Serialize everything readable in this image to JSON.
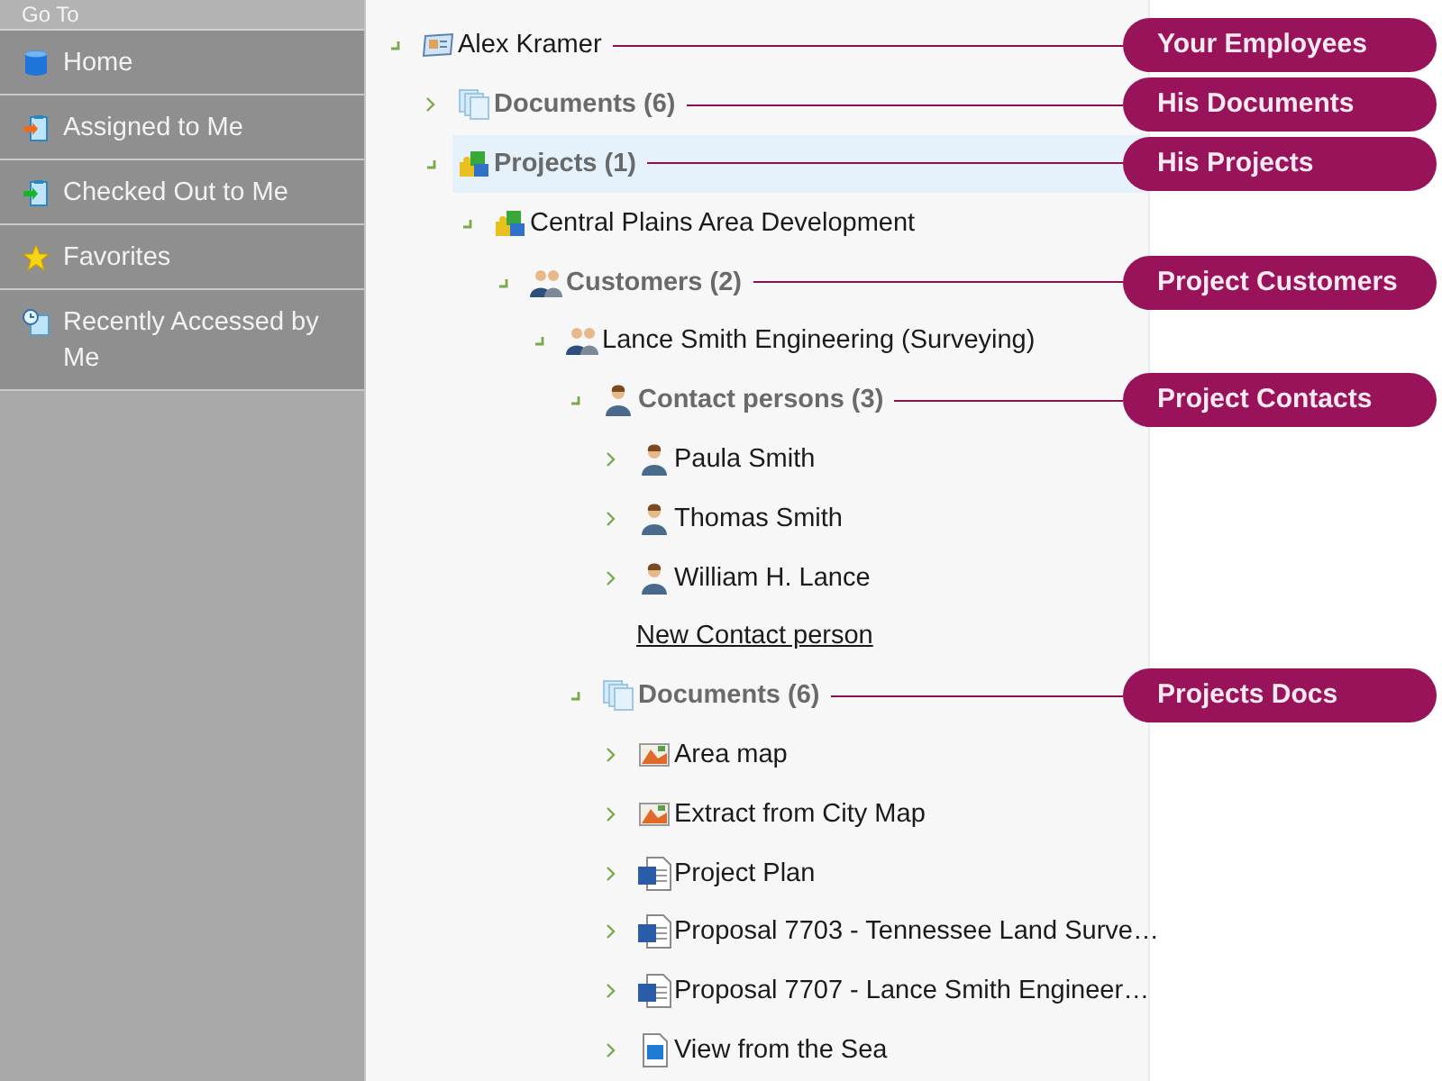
{
  "sidebar": {
    "header": "Go To",
    "items": [
      {
        "label": "Home",
        "kind": "home"
      },
      {
        "label": "Assigned to Me",
        "kind": "assigned"
      },
      {
        "label": "Checked Out to Me",
        "kind": "checkedout"
      },
      {
        "label": "Favorites",
        "kind": "favorites"
      },
      {
        "label": "Recently Accessed by Me",
        "kind": "recent"
      }
    ]
  },
  "tree": [
    {
      "label": "Alex Kramer",
      "kind": "employee",
      "expanded": true,
      "selected": false,
      "callout": "Your Employees",
      "children": [
        {
          "label": "Documents (6)",
          "kind": "documents",
          "expanded": false,
          "selected": false,
          "callout": "His Documents"
        },
        {
          "label": "Projects (1)",
          "kind": "projects",
          "expanded": true,
          "selected": true,
          "callout": "His Projects",
          "children": [
            {
              "label": "Central Plains Area Development",
              "kind": "project",
              "expanded": true,
              "selected": false,
              "children": [
                {
                  "label": "Customers (2)",
                  "kind": "customers",
                  "expanded": true,
                  "selected": false,
                  "callout": "Project Customers",
                  "children": [
                    {
                      "label": "Lance Smith Engineering (Surveying)",
                      "kind": "customer",
                      "expanded": true,
                      "selected": false,
                      "children": [
                        {
                          "label": "Contact persons (3)",
                          "kind": "contacts",
                          "expanded": true,
                          "selected": false,
                          "callout": "Project Contacts",
                          "children": [
                            {
                              "label": "Paula Smith",
                              "kind": "contact",
                              "expanded": false,
                              "selected": false
                            },
                            {
                              "label": "Thomas Smith",
                              "kind": "contact",
                              "expanded": false,
                              "selected": false
                            },
                            {
                              "label": "William H. Lance",
                              "kind": "contact",
                              "expanded": false,
                              "selected": false
                            },
                            {
                              "label": "New Contact person",
                              "kind": "link"
                            }
                          ]
                        },
                        {
                          "label": "Documents (6)",
                          "kind": "documents",
                          "expanded": true,
                          "selected": false,
                          "callout": "Projects Docs",
                          "children": [
                            {
                              "label": "Area map",
                              "kind": "map",
                              "expanded": false,
                              "selected": false
                            },
                            {
                              "label": "Extract from City Map",
                              "kind": "map",
                              "expanded": false,
                              "selected": false
                            },
                            {
                              "label": "Project Plan",
                              "kind": "word",
                              "expanded": false,
                              "selected": false
                            },
                            {
                              "label": "Proposal 7703 - Tennessee Land Surve…",
                              "kind": "word",
                              "expanded": false,
                              "selected": false
                            },
                            {
                              "label": "Proposal 7707 - Lance Smith Engineer…",
                              "kind": "word",
                              "expanded": false,
                              "selected": false
                            },
                            {
                              "label": "View from the Sea",
                              "kind": "image",
                              "expanded": false,
                              "selected": false
                            }
                          ]
                        }
                      ]
                    }
                  ]
                }
              ]
            }
          ]
        }
      ]
    }
  ]
}
